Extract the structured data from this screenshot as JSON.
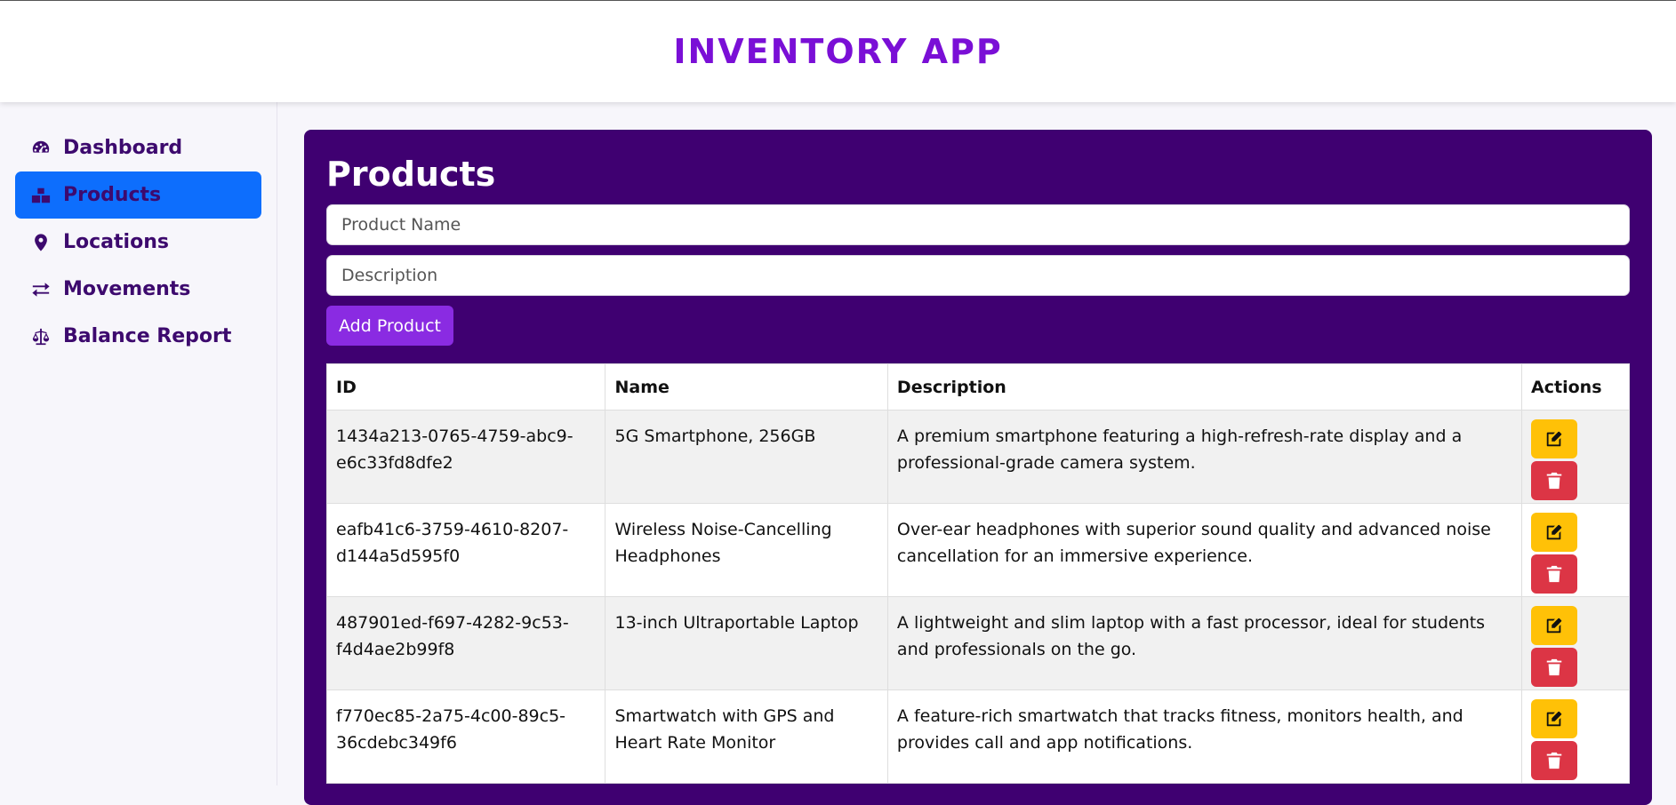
{
  "header": {
    "title": "INVENTORY APP"
  },
  "sidebar": {
    "items": [
      {
        "label": "Dashboard",
        "icon": "tachometer-icon"
      },
      {
        "label": "Products",
        "icon": "boxes-icon",
        "active": true
      },
      {
        "label": "Locations",
        "icon": "map-marker-icon"
      },
      {
        "label": "Movements",
        "icon": "exchange-icon"
      },
      {
        "label": "Balance Report",
        "icon": "balance-scale-icon"
      }
    ]
  },
  "main": {
    "title": "Products",
    "form": {
      "name_placeholder": "Product Name",
      "description_placeholder": "Description",
      "add_label": "Add Product"
    },
    "table": {
      "columns": [
        "ID",
        "Name",
        "Description",
        "Actions"
      ],
      "rows": [
        {
          "id": "1434a213-0765-4759-abc9-e6c33fd8dfe2",
          "name": "5G Smartphone, 256GB",
          "description": "A premium smartphone featuring a high-refresh-rate display and a professional-grade camera system."
        },
        {
          "id": "eafb41c6-3759-4610-8207-d144a5d595f0",
          "name": "Wireless Noise-Cancelling Headphones",
          "description": "Over-ear headphones with superior sound quality and advanced noise cancellation for an immersive experience."
        },
        {
          "id": "487901ed-f697-4282-9c53-f4d4ae2b99f8",
          "name": "13-inch Ultraportable Laptop",
          "description": "A lightweight and slim laptop with a fast processor, ideal for students and professionals on the go."
        },
        {
          "id": "f770ec85-2a75-4c00-89c5-36cdebc349f6",
          "name": "Smartwatch with GPS and Heart Rate Monitor",
          "description": "A feature-rich smartwatch that tracks fitness, monitors health, and provides call and app notifications."
        }
      ]
    }
  },
  "colors": {
    "brand": "#7a0fd6",
    "panel": "#3f0071",
    "active_nav": "#0d6efd",
    "edit": "#ffc107",
    "delete": "#dc3545"
  }
}
